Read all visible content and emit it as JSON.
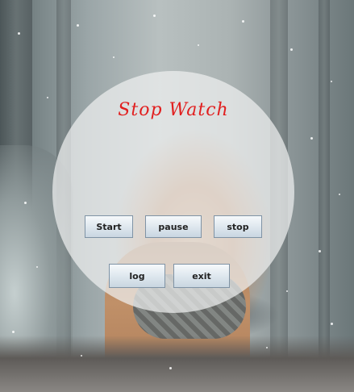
{
  "app": {
    "title": "Stop Watch"
  },
  "buttons": {
    "start": "Start",
    "pause": "pause",
    "stop": "stop",
    "log": "log",
    "exit": "exit"
  },
  "colors": {
    "title": "#e11f1f",
    "button_border": "#7f93a5",
    "panel_fill": "rgba(238,240,240,0.72)"
  }
}
